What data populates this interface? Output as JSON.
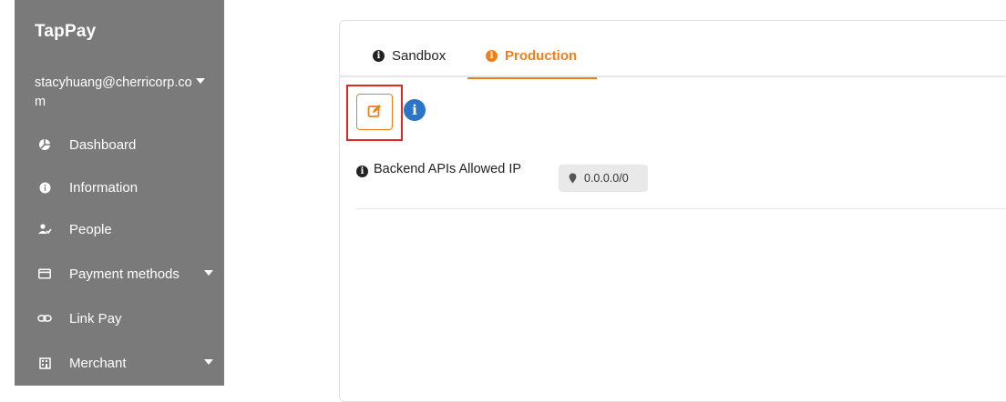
{
  "sidebar": {
    "brand": "TapPay",
    "account_email": "stacyhuang@cherricorp.com",
    "items": [
      {
        "label": "Dashboard",
        "icon": "pie-chart-icon",
        "has_caret": false
      },
      {
        "label": "Information",
        "icon": "info-circle-icon",
        "has_caret": false
      },
      {
        "label": "People",
        "icon": "users-icon",
        "has_caret": false
      },
      {
        "label": "Payment methods",
        "icon": "credit-card-icon",
        "has_caret": true
      },
      {
        "label": "Link Pay",
        "icon": "link-icon",
        "has_caret": false
      },
      {
        "label": "Merchant",
        "icon": "building-icon",
        "has_caret": true
      }
    ]
  },
  "tabs": [
    {
      "label": "Sandbox",
      "icon": "info-circle-icon",
      "active": false
    },
    {
      "label": "Production",
      "icon": "info-circle-icon",
      "active": true
    }
  ],
  "toolbar": {
    "edit_icon": "edit-icon",
    "help_icon": "info-icon"
  },
  "settings": {
    "backend_apis_label": "Backend APIs Allowed IP",
    "allowed_ip": "0.0.0.0/0"
  },
  "colors": {
    "sidebar_bg": "#7a7a7a",
    "accent": "#f07f18",
    "highlight_border": "#e3281e",
    "help_blue": "#2b74c8"
  }
}
